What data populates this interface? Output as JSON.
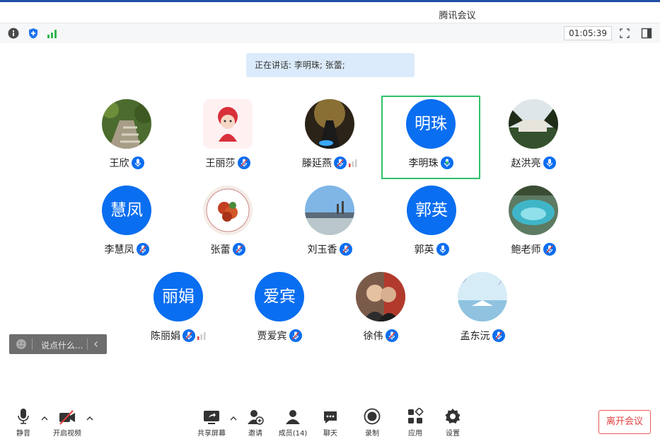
{
  "window": {
    "title": "腾讯会议"
  },
  "infobar": {
    "timer": "01:05:39"
  },
  "speaking": {
    "text": "正在讲话: 李明珠; 张蕾;"
  },
  "participants": [
    {
      "name": "王欣",
      "avatar_type": "image",
      "mic": "on"
    },
    {
      "name": "王丽莎",
      "avatar_type": "image",
      "mic": "muted"
    },
    {
      "name": "滕延燕",
      "avatar_type": "image",
      "mic": "muted",
      "signal_bars": true
    },
    {
      "name": "李明珠",
      "avatar_type": "text",
      "avatar_text": "明珠",
      "mic": "speaking",
      "active": true
    },
    {
      "name": "赵洪亮",
      "avatar_type": "image",
      "mic": "on"
    },
    {
      "name": "李慧凤",
      "avatar_type": "text",
      "avatar_text": "慧凤",
      "mic": "muted"
    },
    {
      "name": "张蕾",
      "avatar_type": "image",
      "mic": "muted"
    },
    {
      "name": "刘玉香",
      "avatar_type": "image",
      "mic": "muted"
    },
    {
      "name": "郭英",
      "avatar_type": "text",
      "avatar_text": "郭英",
      "mic": "on"
    },
    {
      "name": "鲍老师",
      "avatar_type": "image",
      "mic": "muted"
    },
    {
      "name": "陈丽娟",
      "avatar_type": "text",
      "avatar_text": "丽娟",
      "mic": "muted",
      "signal_bars": true
    },
    {
      "name": "贾爱宾",
      "avatar_type": "text",
      "avatar_text": "爱宾",
      "mic": "muted"
    },
    {
      "name": "徐伟",
      "avatar_type": "image",
      "mic": "muted"
    },
    {
      "name": "孟东沅",
      "avatar_type": "image",
      "mic": "muted"
    }
  ],
  "chat": {
    "placeholder": "说点什么..."
  },
  "toolbar": {
    "mute": "静音",
    "video": "开启视频",
    "share": "共享屏幕",
    "invite": "邀请",
    "members": "成员(14)",
    "chat": "聊天",
    "record": "录制",
    "apps": "应用",
    "settings": "设置",
    "leave": "离开会议"
  },
  "colors": {
    "accent": "#0a6ef0",
    "active_border": "#2ec26a",
    "leave": "#e0403f"
  }
}
